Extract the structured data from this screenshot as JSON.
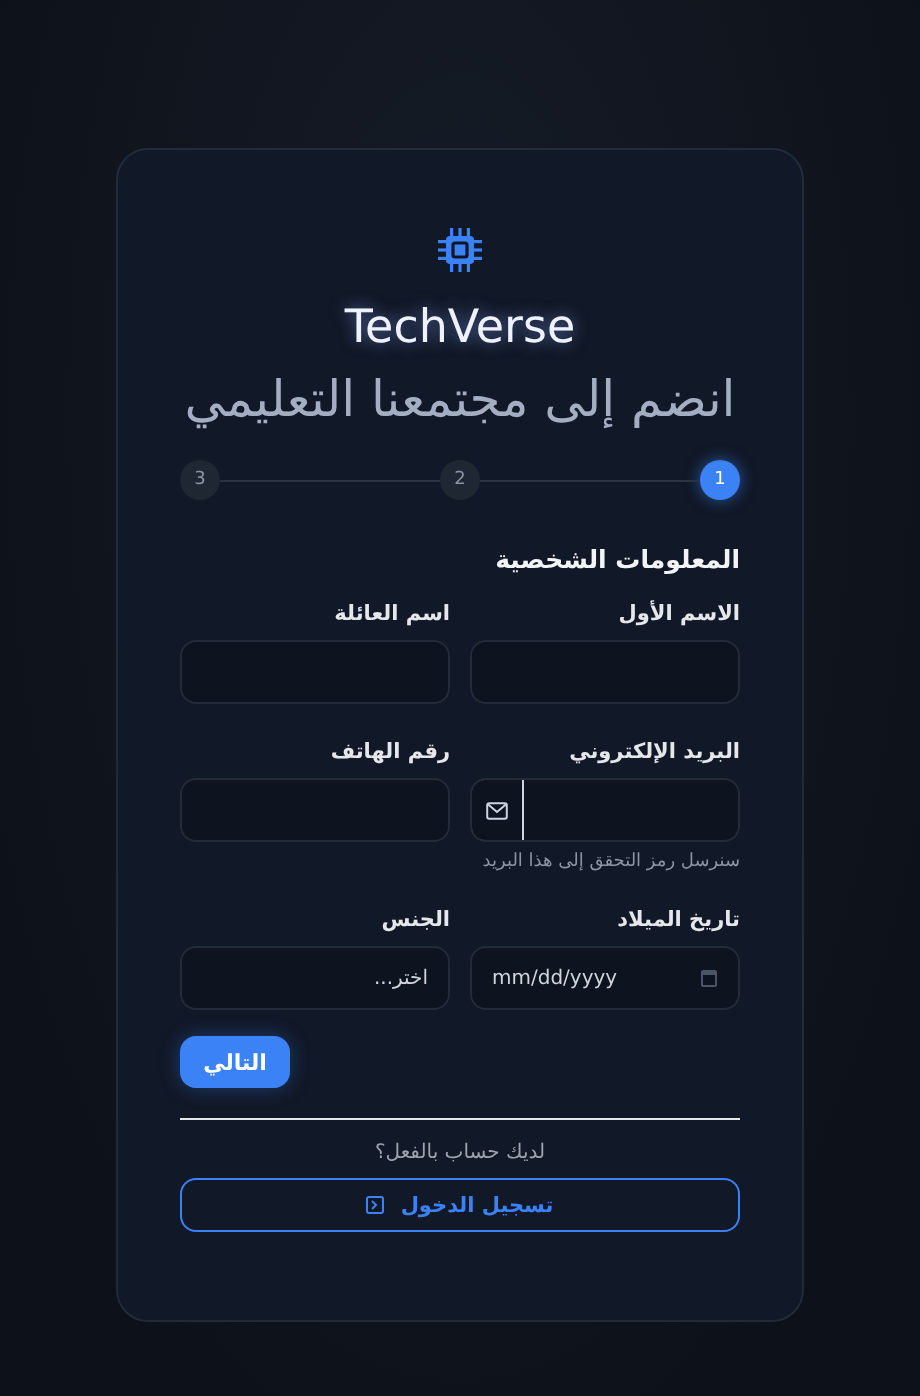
{
  "brand": {
    "name": "TechVerse"
  },
  "heading": "انضم إلى مجتمعنا التعليمي",
  "steps": [
    {
      "label": "1",
      "selected": true
    },
    {
      "label": "2",
      "selected": false
    },
    {
      "label": "3",
      "selected": false
    }
  ],
  "section_title": "المعلومات الشخصية",
  "fields": [
    {
      "kind": "text",
      "label": "الاسم الأول"
    },
    {
      "kind": "text",
      "label": "اسم العائلة"
    },
    {
      "kind": "email",
      "label": "البريد الإلكتروني",
      "hint": "سنرسل رمز التحقق إلى هذا البريد"
    },
    {
      "kind": "text",
      "label": "رقم الهاتف"
    },
    {
      "kind": "date",
      "label": "تاريخ الميلاد",
      "placeholder": "mm/dd/yyyy"
    },
    {
      "kind": "select",
      "label": "الجنس",
      "value": "اختر..."
    }
  ],
  "next_button": "التالي",
  "login_prompt": "لديك حساب بالفعل؟",
  "login_button": "تسجيل الدخول"
}
